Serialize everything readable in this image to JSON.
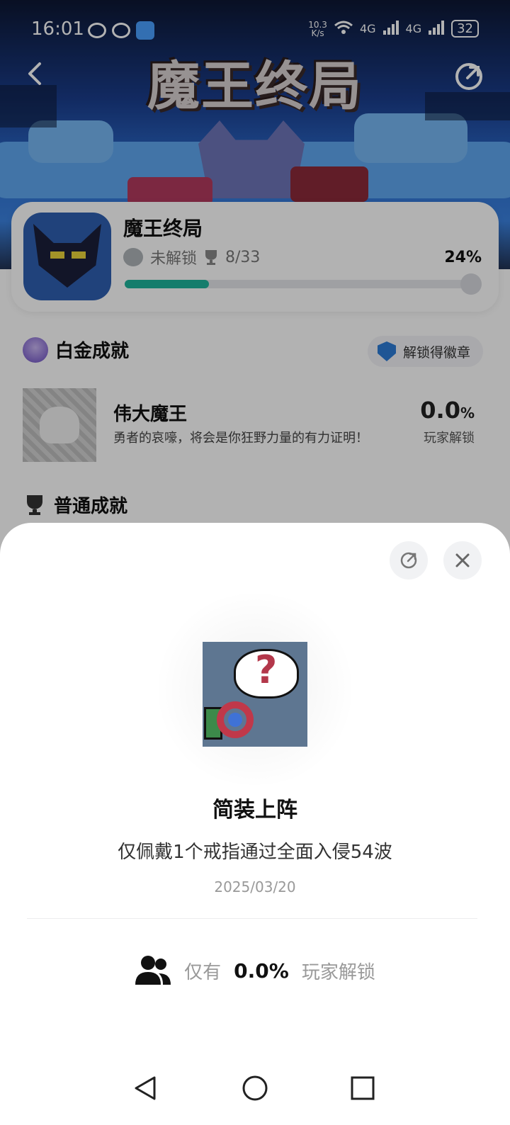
{
  "status_bar": {
    "time": "16:01",
    "net_speed": "10.3",
    "net_unit": "K/s",
    "signal_label": "4G",
    "battery": "32"
  },
  "header": {
    "game_logo": "魔王终局"
  },
  "game_card": {
    "name": "魔王终局",
    "lock_status": "未解锁",
    "trophy_count": "8/33",
    "percent": "24%",
    "progress_fraction": 0.24
  },
  "platinum": {
    "section_title": "白金成就",
    "badge_button": "解锁得徽章",
    "item": {
      "title": "伟大魔王",
      "desc": "勇者的哀嚎，将会是你狂野力量的有力证明！",
      "pct_value": "0.0",
      "pct_unit": "%",
      "pct_label": "玩家解锁"
    }
  },
  "normal": {
    "section_title": "普通成就"
  },
  "sheet": {
    "title": "简装上阵",
    "desc": "仅佩戴1个戒指通过全面入侵54波",
    "date": "2025/03/20",
    "stat_prefix": "仅有",
    "stat_value": "0.0%",
    "stat_suffix": "玩家解锁"
  },
  "icons": {
    "back": "back-icon",
    "share": "share-icon",
    "close": "close-icon",
    "users": "users-icon",
    "trophy": "trophy-icon"
  },
  "colors": {
    "progress": "#1fb39b",
    "badge_shield": "#2d7bd6"
  }
}
